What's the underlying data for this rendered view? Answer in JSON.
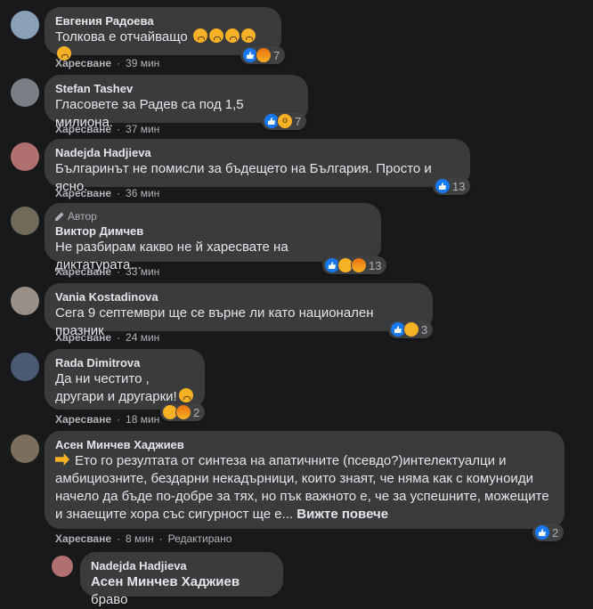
{
  "like_label": "Харесване",
  "comments": [
    {
      "name": "Евгения Радоева",
      "text": "Толкова е отчайващо",
      "emoji_count": 5,
      "time": "39 мин",
      "reaction_count": "7",
      "reactions": [
        "like",
        "angry"
      ],
      "avatar_color": "#8aa0b5"
    },
    {
      "name": "Stefan Tashev",
      "text": "Гласовете за Радев са под 1,5 милиона.",
      "time": "37 мин",
      "reaction_count": "7",
      "reactions": [
        "like",
        "wow"
      ],
      "avatar_color": "#7a7f86"
    },
    {
      "name": "Nadejda Hadjieva",
      "text": "Българинът не помисли за бъдещето на България. Просто и ясно.",
      "time": "36 мин",
      "reaction_count": "13",
      "reactions": [
        "like"
      ],
      "avatar_color": "#b07070"
    },
    {
      "name": "Виктор Димчев",
      "author_tag": "Автор",
      "text": "Не разбирам какво не й харесвате на диктатурата...",
      "time": "33 мин",
      "reaction_count": "13",
      "reactions": [
        "like",
        "sad",
        "angry"
      ],
      "avatar_color": "#6f6a5a"
    },
    {
      "name": "Vania Kostadinova",
      "text": "Сега 9 септември ще се върне ли като национален празник",
      "time": "24 мин",
      "reaction_count": "3",
      "reactions": [
        "like",
        "haha"
      ],
      "avatar_color": "#9a8f86"
    },
    {
      "name": "Rada Dimitrova",
      "text_line1": "Да ни честито ,",
      "text_line2": "другари и другарки!",
      "time": "18 мин",
      "reaction_count": "2",
      "reactions": [
        "sad",
        "angry"
      ],
      "avatar_color": "#4a5a70"
    },
    {
      "name": "Асен Минчев Хаджиев",
      "text": "Ето го резултата от синтеза на апатичните (псевдо?)интелектуалци и\nамбициозните, бездарни некадърници, които знаят, че няма как с комуноиди\nначело да бъде по-добре за тях, но пък важното е, че за успешните, можещите\nи знаещите хора със сигурност ще е... ",
      "see_more": "Вижте повече",
      "time": "8 мин",
      "edited": "Редактирано",
      "reaction_count": "2",
      "reactions": [
        "like"
      ],
      "avatar_color": "#7c6e5e"
    }
  ],
  "reply": {
    "name": "Nadejda Hadjieva",
    "mention": "Асен Минчев Хаджиев",
    "text": " браво",
    "avatar_color": "#b07070"
  }
}
